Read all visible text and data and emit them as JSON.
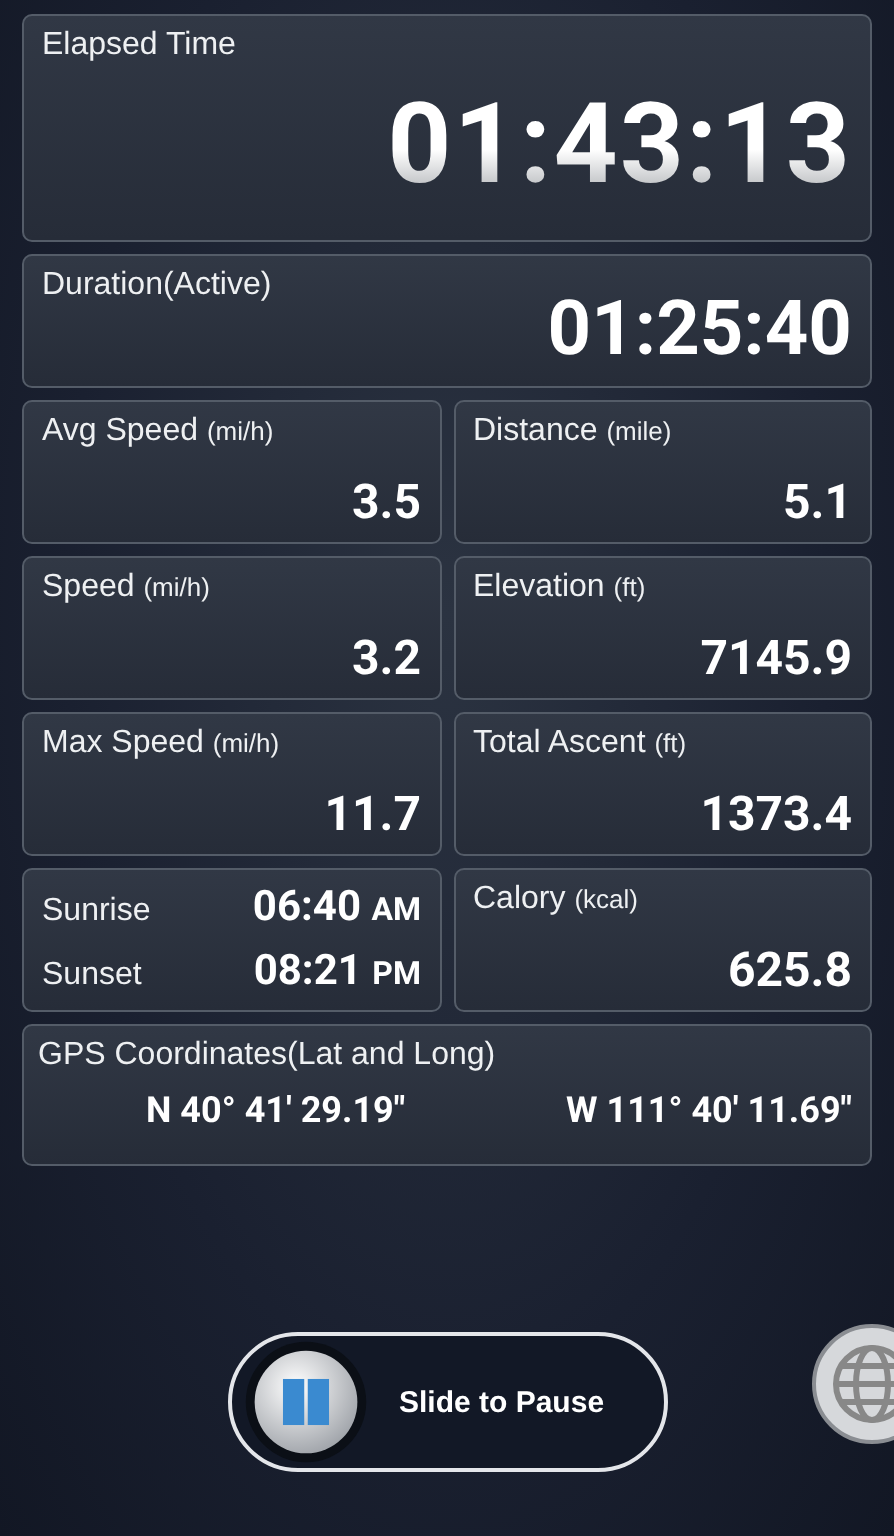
{
  "elapsed": {
    "label": "Elapsed Time",
    "value": "01:43:13"
  },
  "duration": {
    "label": "Duration(Active)",
    "value": "01:25:40"
  },
  "tiles": [
    {
      "kind": "stat",
      "label": "Avg Speed",
      "unit": "(mi/h)",
      "value": "3.5"
    },
    {
      "kind": "stat",
      "label": "Distance",
      "unit": "(mile)",
      "value": "5.1"
    },
    {
      "kind": "stat",
      "label": "Speed",
      "unit": "(mi/h)",
      "value": "3.2"
    },
    {
      "kind": "stat",
      "label": "Elevation",
      "unit": "(ft)",
      "value": "7145.9"
    },
    {
      "kind": "stat",
      "label": "Max Speed",
      "unit": "(mi/h)",
      "value": "11.7"
    },
    {
      "kind": "stat",
      "label": "Total Ascent",
      "unit": "(ft)",
      "value": "1373.4"
    },
    {
      "kind": "sun",
      "rows": [
        {
          "label": "Sunrise",
          "time": "06:40",
          "ampm": "AM"
        },
        {
          "label": "Sunset",
          "time": "08:21",
          "ampm": "PM"
        }
      ]
    },
    {
      "kind": "stat",
      "label": "Calory",
      "unit": "(kcal)",
      "value": "625.8"
    }
  ],
  "gps": {
    "label": "GPS Coordinates(Lat and Long)",
    "lat": "N 40° 41' 29.19\"",
    "long": "W 111° 40' 11.69\""
  },
  "slider": {
    "label": "Slide to Pause",
    "level": 0
  }
}
